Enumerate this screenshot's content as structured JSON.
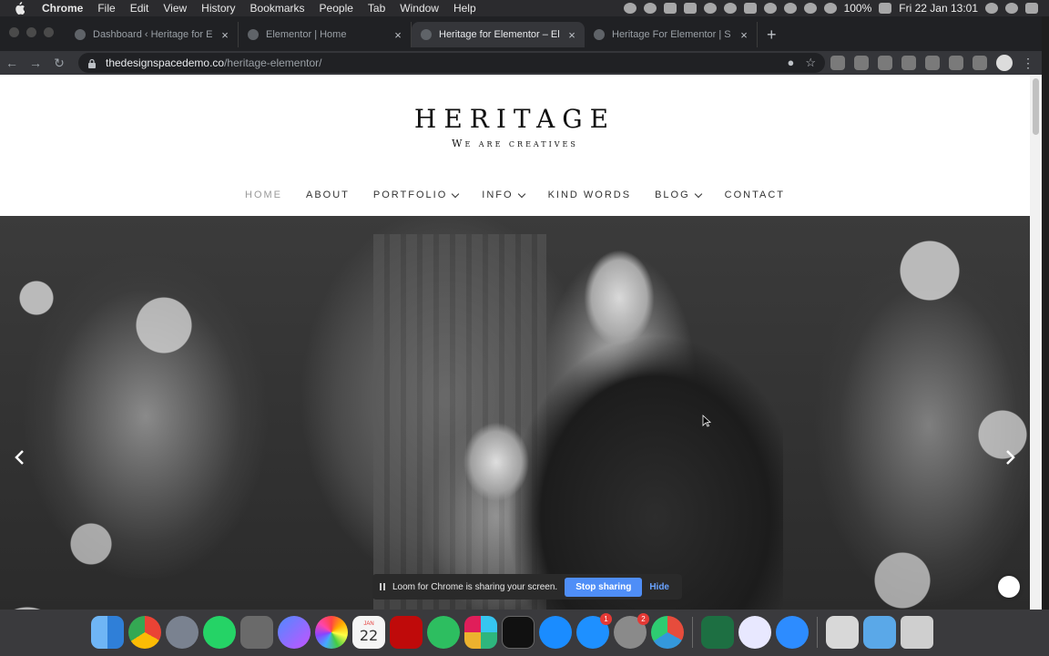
{
  "menubar": {
    "app": "Chrome",
    "menus": [
      "File",
      "Edit",
      "View",
      "History",
      "Bookmarks",
      "People",
      "Tab",
      "Window",
      "Help"
    ],
    "battery": "100%",
    "datetime": "Fri 22 Jan  13:01"
  },
  "browser": {
    "tabs": [
      {
        "title": "Dashboard ‹ Heritage for Elem",
        "close": "×"
      },
      {
        "title": "Elementor | Home",
        "close": "×"
      },
      {
        "title": "Heritage for Elementor – Eleme",
        "close": "×"
      },
      {
        "title": "Heritage For Elementor | Supp",
        "close": "×"
      }
    ],
    "new_tab": "+",
    "url_host": "thedesignspacedemo.co",
    "url_path": "/heritage-elementor/"
  },
  "site": {
    "logo": "HERITAGE",
    "tagline": "We are creatives",
    "nav": [
      {
        "label": "HOME"
      },
      {
        "label": "ABOUT"
      },
      {
        "label": "PORTFOLIO"
      },
      {
        "label": "INFO"
      },
      {
        "label": "KIND WORDS"
      },
      {
        "label": "BLOG"
      },
      {
        "label": "CONTACT"
      }
    ]
  },
  "loom": {
    "message": "Loom for Chrome is sharing your screen.",
    "stop": "Stop sharing",
    "hide": "Hide"
  },
  "dock": {
    "calendar_month": "JAN",
    "calendar_day": "22",
    "appstore_badge": "1",
    "prefs_badge": "2"
  },
  "colors": {
    "menu_nav_active": "#9a9a9a",
    "loom_button": "#4f8ef7",
    "hide_link": "#6aa3ff"
  }
}
